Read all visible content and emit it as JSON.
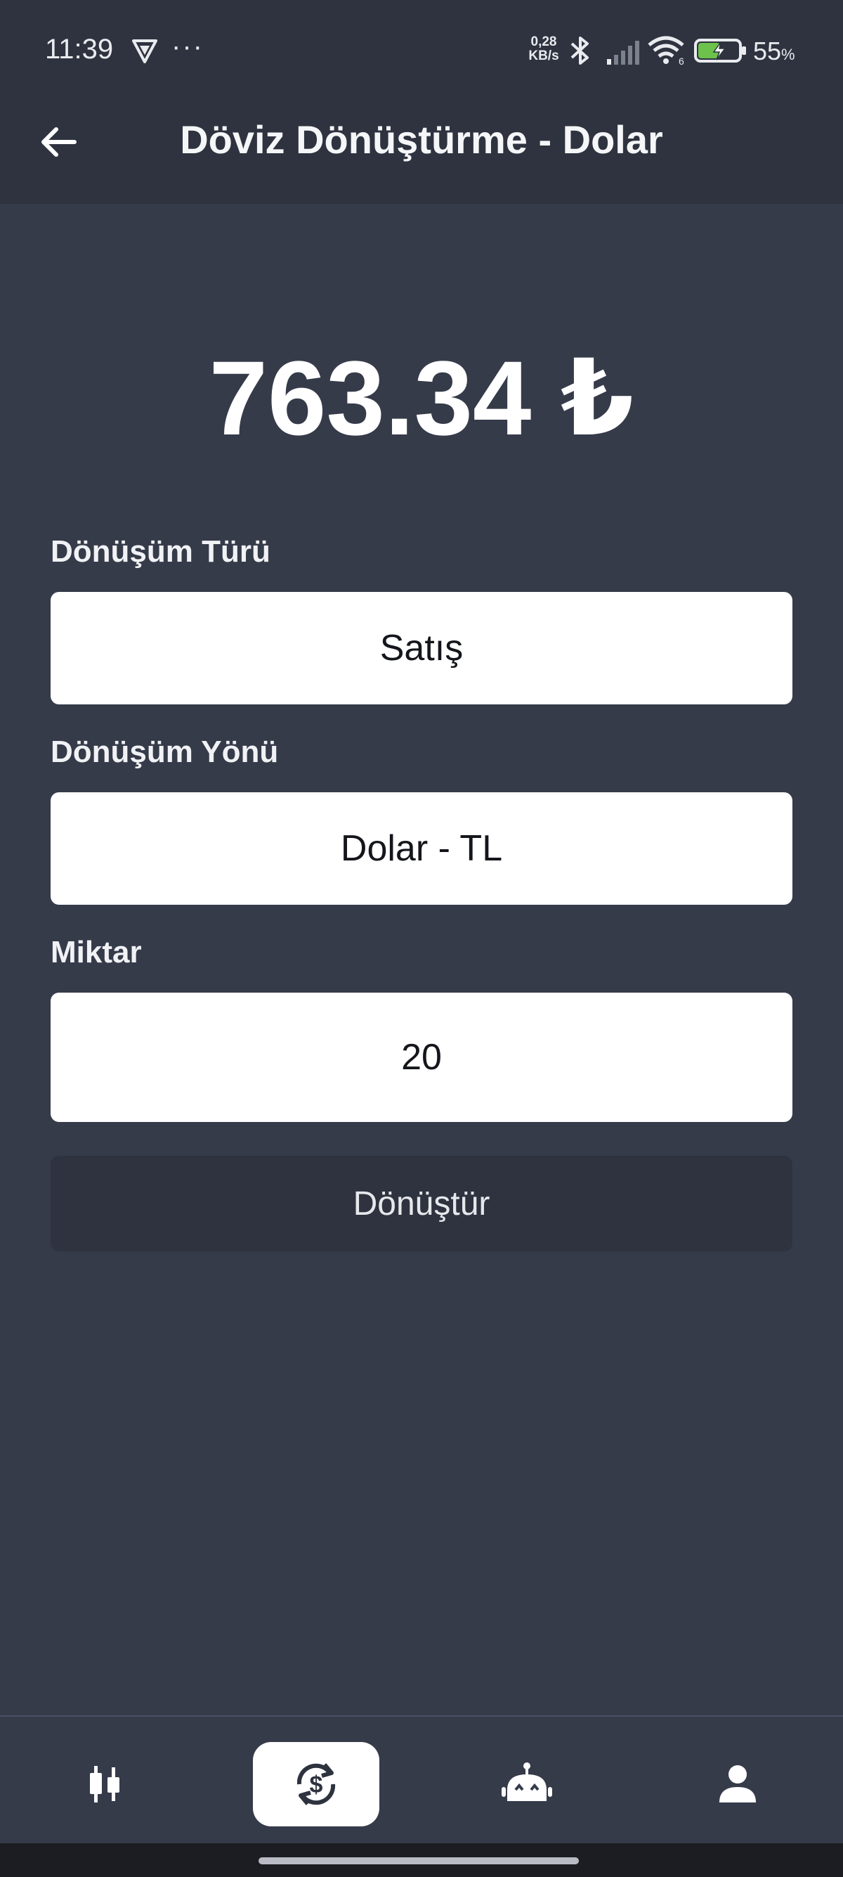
{
  "status_bar": {
    "time": "11:39",
    "dots": "···",
    "net_speed_value": "0,28",
    "net_speed_unit": "KB/s",
    "wifi_badge": "6",
    "battery_percent": "55",
    "battery_symbol": "%",
    "battery_level": 0.55,
    "icons": [
      "vpn-icon",
      "bluetooth-icon",
      "signal-icon",
      "wifi-icon",
      "battery-charging-icon"
    ]
  },
  "app_bar": {
    "back_icon": "arrow-left-icon",
    "title": "Döviz Dönüştürme - Dolar"
  },
  "result": {
    "value": "763.34 ₺"
  },
  "form": {
    "type_label": "Dönüşüm Türü",
    "type_value": "Satış",
    "direction_label": "Dönüşüm Yönü",
    "direction_value": "Dolar - TL",
    "amount_label": "Miktar",
    "amount_value": "20",
    "convert_button": "Dönüştür"
  },
  "bottom_nav": {
    "items": [
      {
        "icon": "candlestick-chart-icon",
        "active": false
      },
      {
        "icon": "currency-exchange-icon",
        "active": true
      },
      {
        "icon": "robot-icon",
        "active": false
      },
      {
        "icon": "user-icon",
        "active": false
      }
    ]
  },
  "colors": {
    "background": "#363b4a",
    "bar": "#2e333f",
    "field": "#ffffff",
    "text": "#ffffff",
    "battery_green": "#6cc24a"
  }
}
